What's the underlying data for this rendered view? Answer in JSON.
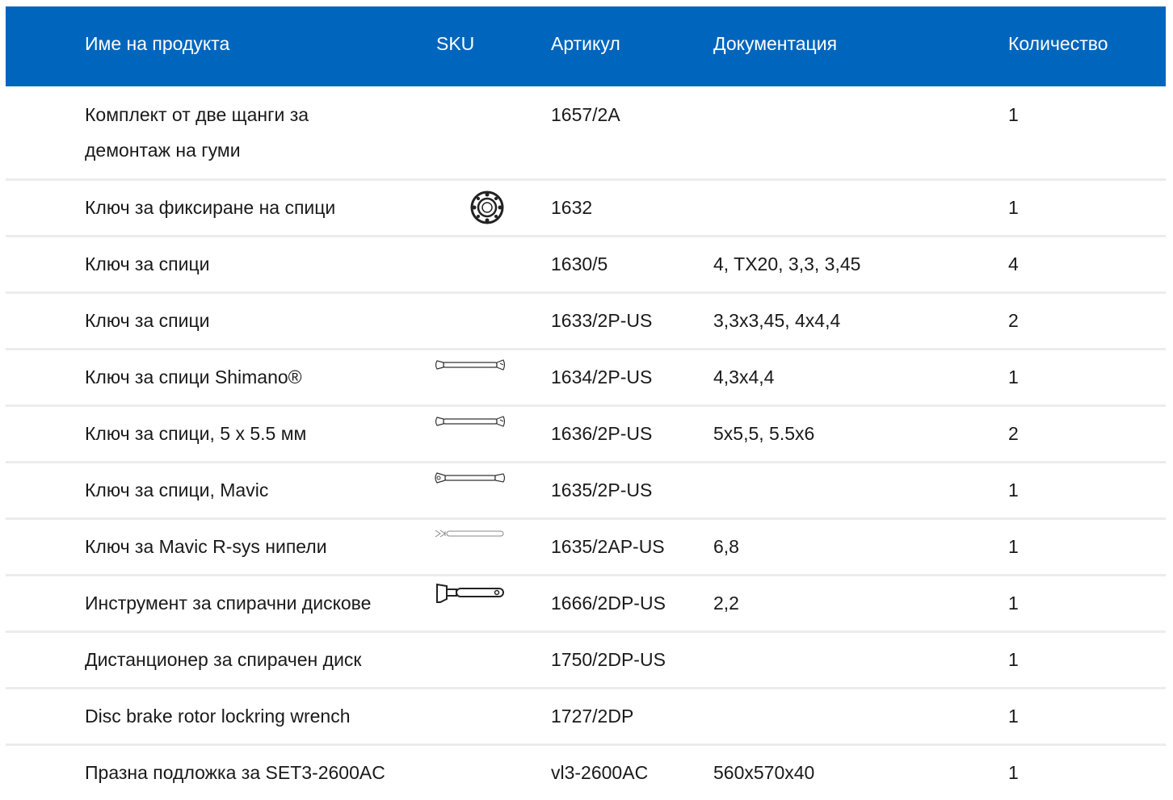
{
  "header": {
    "name": "Име на продукта",
    "sku": "SKU",
    "article": "Артикул",
    "documentation": "Документация",
    "quantity": "Количество"
  },
  "rows": [
    {
      "name": "Комплект от две щанги за демонтаж на гуми",
      "article": "1657/2A",
      "doc": "",
      "qty": "1",
      "icon": ""
    },
    {
      "name": "Ключ за фиксиране на спици",
      "article": "1632",
      "doc": "",
      "qty": "1",
      "icon": "lockring-tool-icon"
    },
    {
      "name": "Ключ за спици",
      "article": "1630/5",
      "doc": "4, TX20, 3,3, 3,45",
      "qty": "4",
      "icon": ""
    },
    {
      "name": "Ключ за спици",
      "article": "1633/2P-US",
      "doc": "3,3x3,45, 4x4,4",
      "qty": "2",
      "icon": ""
    },
    {
      "name": "Ключ за спици Shimano®",
      "article": "1634/2P-US",
      "doc": "4,3x4,4",
      "qty": "1",
      "icon": "spoke-wrench-icon"
    },
    {
      "name": "Ключ за спици, 5 x 5.5 мм",
      "article": "1636/2P-US",
      "doc": "5x5,5, 5.5x6",
      "qty": "2",
      "icon": "spoke-wrench-icon"
    },
    {
      "name": "Ключ за спици, Mavic",
      "article": "1635/2P-US",
      "doc": "",
      "qty": "1",
      "icon": "spoke-wrench-icon"
    },
    {
      "name": "Ключ за Mavic R-sys нипели",
      "article": "1635/2AP-US",
      "doc": "6,8",
      "qty": "1",
      "icon": "nipple-key-icon"
    },
    {
      "name": "Инструмент за спирачни дискове",
      "article": "1666/2DP-US",
      "doc": "2,2",
      "qty": "1",
      "icon": "rotor-truing-tool-icon"
    },
    {
      "name": "Дистанционер за спирачен диск",
      "article": "1750/2DP-US",
      "doc": "",
      "qty": "1",
      "icon": ""
    },
    {
      "name": "Disc brake rotor lockring wrench",
      "article": "1727/2DP",
      "doc": "",
      "qty": "1",
      "icon": ""
    },
    {
      "name": "Празна подложка за SET3-2600AC",
      "article": "vl3-2600AC",
      "doc": "560x570x40",
      "qty": "1",
      "icon": ""
    }
  ],
  "colors": {
    "header_bg": "#0066bd",
    "header_text": "#ffffff",
    "row_divider": "#ececec"
  }
}
